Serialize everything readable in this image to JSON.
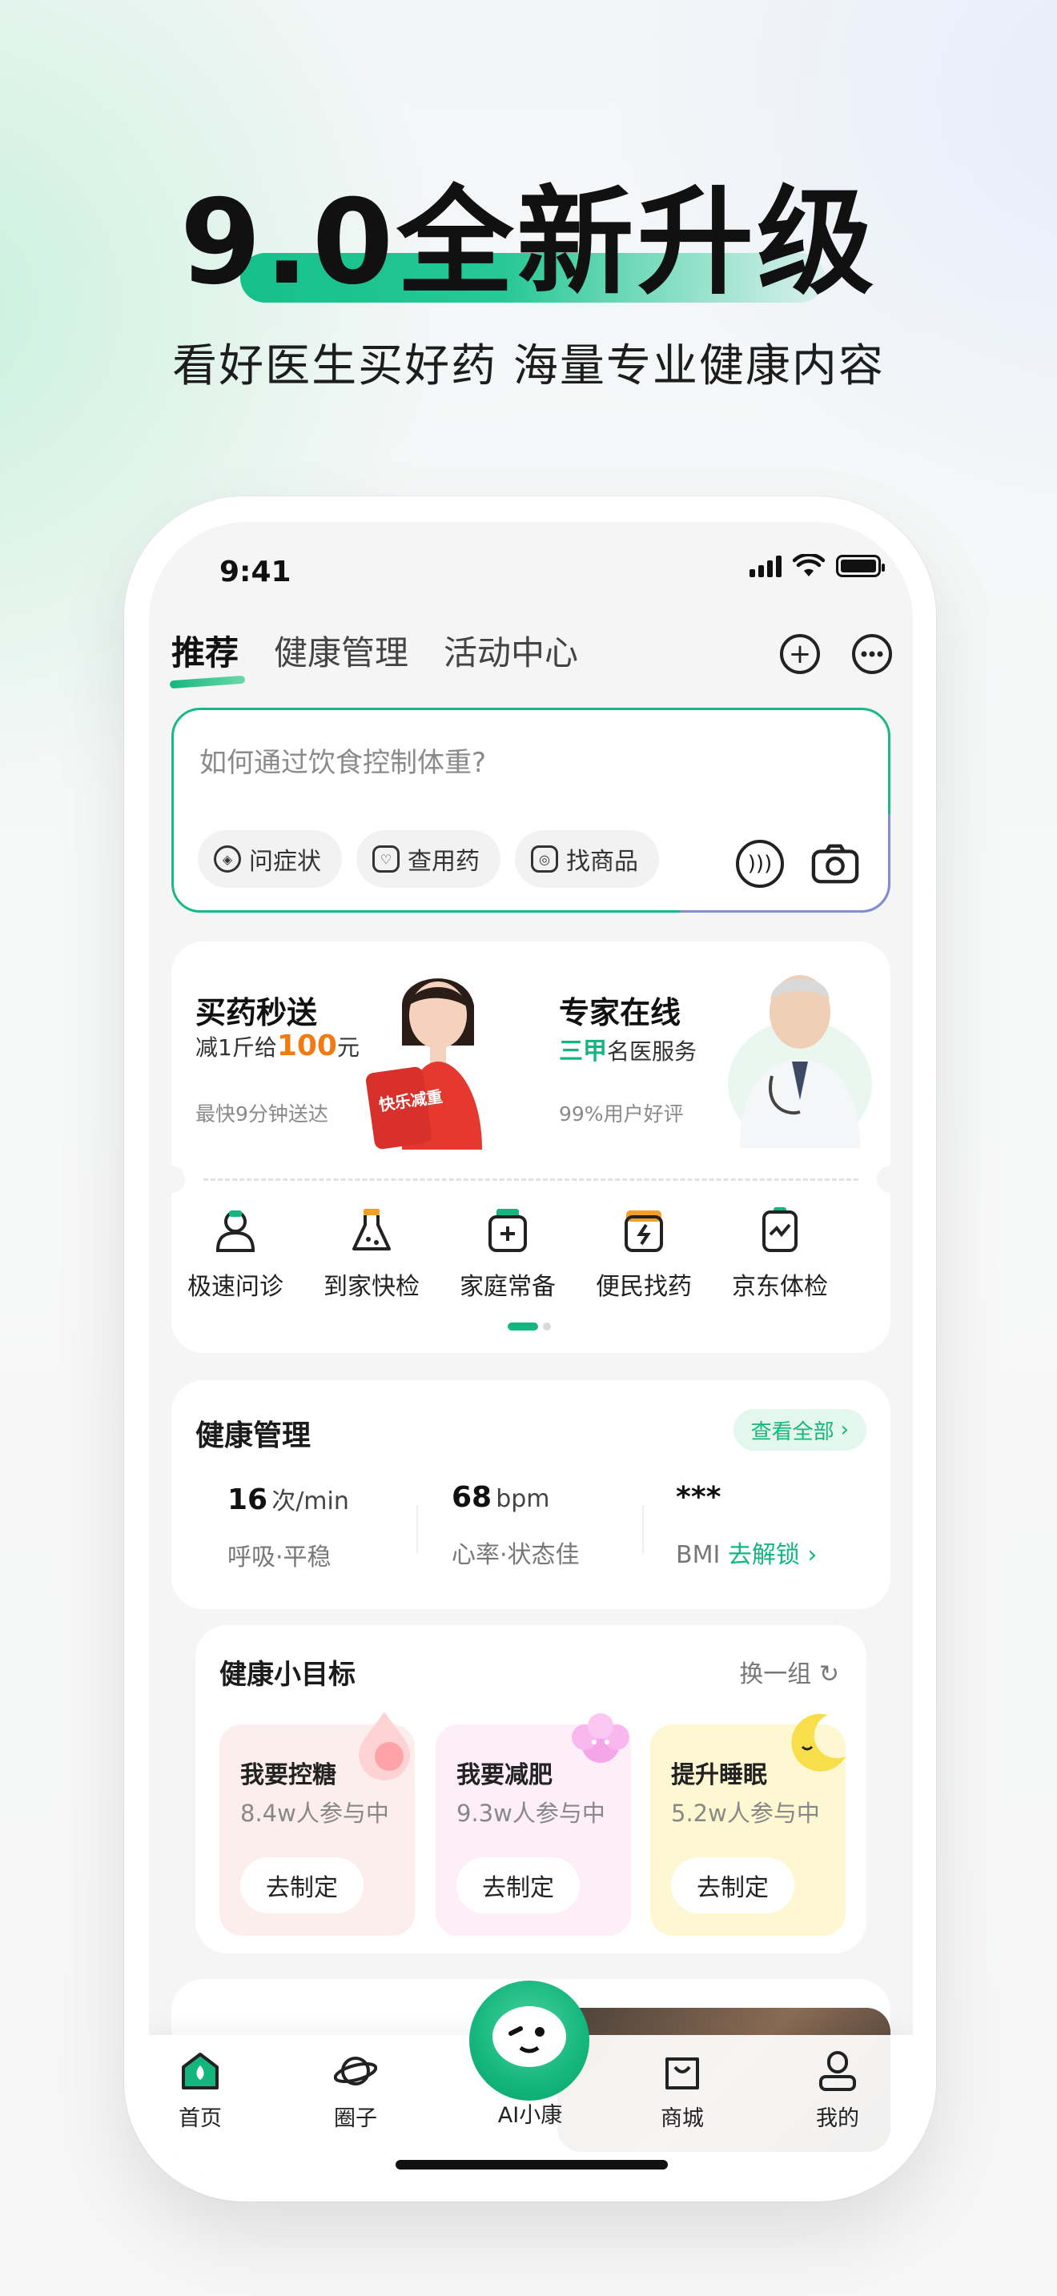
{
  "hero": {
    "title": "9.0全新升级",
    "subtitle": "看好医生买好药  海量专业健康内容"
  },
  "status_bar": {
    "time": "9:41"
  },
  "tabs": [
    {
      "label": "推荐",
      "active": true
    },
    {
      "label": "健康管理",
      "active": false
    },
    {
      "label": "活动中心",
      "active": false
    }
  ],
  "search": {
    "placeholder": "如何通过饮食控制体重?",
    "chips": [
      "问症状",
      "查用药",
      "找商品"
    ]
  },
  "promo": {
    "left": {
      "title": "买药秒送",
      "sub_prefix": "减1斤给",
      "sub_amount": "100",
      "sub_unit": "元",
      "note": "最快9分钟送达",
      "badge": "快乐减重"
    },
    "right": {
      "title": "专家在线",
      "sub_highlight": "三甲",
      "sub_rest": "名医服务",
      "note": "99%用户好评"
    },
    "services": [
      "极速问诊",
      "到家快检",
      "家庭常备",
      "便民找药",
      "京东体检"
    ]
  },
  "health": {
    "title": "健康管理",
    "view_all": "查看全部",
    "metrics": [
      {
        "value": "16",
        "unit": "次/min",
        "desc": "呼吸·平稳"
      },
      {
        "value": "68",
        "unit": "bpm",
        "desc": "心率·状态佳"
      },
      {
        "value": "***",
        "unit": "",
        "desc": "BMI",
        "action": "去解锁"
      }
    ]
  },
  "goals": {
    "title": "健康小目标",
    "swap": "换一组",
    "items": [
      {
        "title": "我要控糖",
        "participants": "8.4w人参与中",
        "button": "去制定",
        "bg": "#fdeeee"
      },
      {
        "title": "我要减肥",
        "participants": "9.3w人参与中",
        "button": "去制定",
        "bg": "#fdeef8"
      },
      {
        "title": "提升睡眠",
        "participants": "5.2w人参与中",
        "button": "去制定",
        "bg": "#fdf8d2"
      }
    ]
  },
  "nav": [
    {
      "label": "首页",
      "icon": "home-icon"
    },
    {
      "label": "圈子",
      "icon": "planet-icon"
    },
    {
      "label": "AI小康",
      "icon": "mascot-icon"
    },
    {
      "label": "商城",
      "icon": "bag-icon"
    },
    {
      "label": "我的",
      "icon": "person-icon"
    }
  ],
  "colors": {
    "accent": "#14b67e",
    "orange": "#f07b12"
  }
}
